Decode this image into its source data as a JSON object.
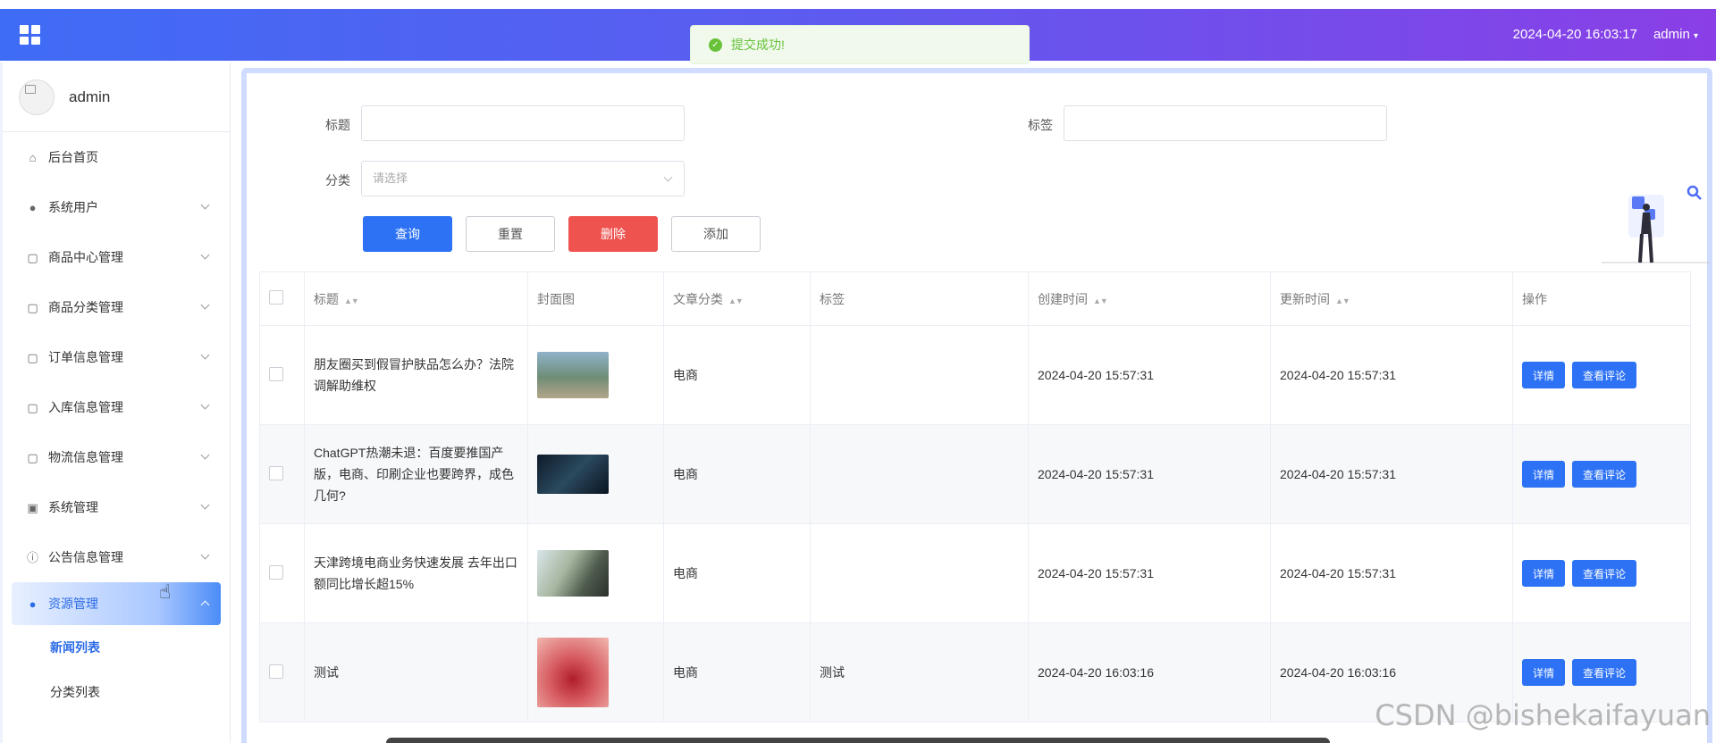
{
  "header": {
    "datetime": "2024-04-20 16:03:17",
    "user": "admin"
  },
  "toast": {
    "message": "提交成功!",
    "color": "#67c23a"
  },
  "sidebar": {
    "username": "admin",
    "items": [
      {
        "label": "后台首页",
        "icon": "home-icon"
      },
      {
        "label": "系统用户",
        "icon": "user-icon"
      },
      {
        "label": "商品中心管理",
        "icon": "folder-icon"
      },
      {
        "label": "商品分类管理",
        "icon": "folder-icon"
      },
      {
        "label": "订单信息管理",
        "icon": "folder-icon"
      },
      {
        "label": "入库信息管理",
        "icon": "folder-icon"
      },
      {
        "label": "物流信息管理",
        "icon": "folder-icon"
      },
      {
        "label": "系统管理",
        "icon": "image-icon"
      },
      {
        "label": "公告信息管理",
        "icon": "info-icon"
      },
      {
        "label": "资源管理",
        "icon": "bulb-icon"
      }
    ],
    "sub_items": [
      {
        "label": "新闻列表"
      },
      {
        "label": "分类列表"
      }
    ]
  },
  "filters": {
    "title_label": "标题",
    "tag_label": "标签",
    "category_label": "分类",
    "category_placeholder": "请选择"
  },
  "buttons": {
    "query": "查询",
    "reset": "重置",
    "delete": "删除",
    "add": "添加"
  },
  "table": {
    "headers": [
      "标题",
      "封面图",
      "文章分类",
      "标签",
      "创建时间",
      "更新时间",
      "操作"
    ],
    "rows": [
      {
        "title": "朋友圈买到假冒护肤品怎么办？法院调解助维权",
        "category": "电商",
        "tag": "",
        "created": "2024-04-20 15:57:31",
        "updated": "2024-04-20 15:57:31"
      },
      {
        "title": "ChatGPT热潮未退：百度要推国产版，电商、印刷企业也要跨界，成色几何?",
        "category": "电商",
        "tag": "",
        "created": "2024-04-20 15:57:31",
        "updated": "2024-04-20 15:57:31"
      },
      {
        "title": "天津跨境电商业务快速发展 去年出口额同比增长超15%",
        "category": "电商",
        "tag": "",
        "created": "2024-04-20 15:57:31",
        "updated": "2024-04-20 15:57:31"
      },
      {
        "title": "测试",
        "category": "电商",
        "tag": "测试",
        "created": "2024-04-20 16:03:16",
        "updated": "2024-04-20 16:03:16"
      }
    ],
    "action_detail": "详情",
    "action_comments": "查看评论"
  },
  "watermark": "CSDN @bishekaifayuan",
  "colors": {
    "primary": "#2d72f5",
    "danger": "#ee5350",
    "success": "#67c23a"
  }
}
